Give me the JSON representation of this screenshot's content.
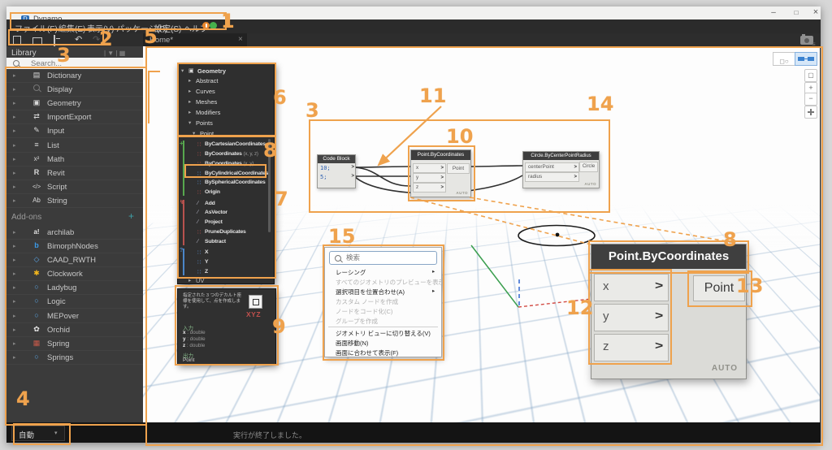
{
  "window": {
    "title": "Dynamo"
  },
  "menu": {
    "items": [
      "ファイル(F)",
      "編集(E)",
      "表示(V)",
      "パッケージ(P)",
      "設定(S)",
      "ヘルプ"
    ]
  },
  "tab": {
    "label": "Home*"
  },
  "library": {
    "title": "Library",
    "search_placeholder": "Search...",
    "categories": [
      {
        "label": "Dictionary",
        "icon": "book-icon"
      },
      {
        "label": "Display",
        "icon": "magnifier-icon"
      },
      {
        "label": "Geometry",
        "icon": "cube-icon"
      },
      {
        "label": "ImportExport",
        "icon": "arrows-icon"
      },
      {
        "label": "Input",
        "icon": "pen-icon"
      },
      {
        "label": "List",
        "icon": "list-icon"
      },
      {
        "label": "Math",
        "icon": "math-icon"
      },
      {
        "label": "Revit",
        "icon": "revit-icon"
      },
      {
        "label": "Script",
        "icon": "code-icon"
      },
      {
        "label": "String",
        "icon": "text-icon"
      }
    ],
    "addons_title": "Add-ons",
    "addons": [
      {
        "label": "archilab",
        "icon": "archilab-icon"
      },
      {
        "label": "BimorphNodes",
        "icon": "bimorph-icon"
      },
      {
        "label": "CAAD_RWTH",
        "icon": "package-icon"
      },
      {
        "label": "Clockwork",
        "icon": "gear-icon"
      },
      {
        "label": "Ladybug",
        "icon": "package-icon"
      },
      {
        "label": "Logic",
        "icon": "package-icon"
      },
      {
        "label": "MEPover",
        "icon": "package-icon"
      },
      {
        "label": "Orchid",
        "icon": "flower-icon"
      },
      {
        "label": "Spring",
        "icon": "spring-icon"
      },
      {
        "label": "Springs",
        "icon": "package-icon"
      }
    ]
  },
  "runbar": {
    "mode": "自動",
    "status": "実行が終了しました。"
  },
  "tree": {
    "root": "Geometry",
    "cats": [
      "Abstract",
      "Curves",
      "Meshes",
      "Modifiers",
      "Points",
      "Point"
    ],
    "create": [
      {
        "name": "ByCartesianCoordinates",
        "params": ""
      },
      {
        "name": "ByCoordinates",
        "params": "(x, y, z)"
      },
      {
        "name": "ByCoordinates",
        "params": "(x, y)"
      },
      {
        "name": "ByCylindricalCoordinates",
        "params": ""
      },
      {
        "name": "BySphericalCoordinates",
        "params": ""
      },
      {
        "name": "Origin",
        "params": ""
      }
    ],
    "action": [
      "Add",
      "AsVector",
      "Project",
      "PruneDuplicates",
      "Subtract"
    ],
    "query": [
      "X",
      "Y",
      "Z"
    ],
    "footer": "UV"
  },
  "tooltip": {
    "desc": "指定された 3 つのデカルト座標を使用して、点を作成します。",
    "icon_text": "XYZ",
    "inputs_title": "入力",
    "rows": [
      {
        "n": "x",
        "t": " : double"
      },
      {
        "n": "y",
        "t": " : double"
      },
      {
        "n": "z",
        "t": " : double"
      }
    ],
    "outputs_title": "出力",
    "output": "Point"
  },
  "graph": {
    "code_block": {
      "title": "Code Block",
      "lines": [
        "10;",
        "5;"
      ]
    },
    "point": {
      "title": "Point.ByCoordinates",
      "in0": "x",
      "in1": "y",
      "in2": "z",
      "output": "Point",
      "badge": "AUTO"
    },
    "circle": {
      "title": "Circle.ByCenterPointRadius",
      "in0": "centerPoint",
      "in1": "radius",
      "output": "Circle",
      "badge": "AUTO"
    }
  },
  "context_menu": {
    "search_placeholder": "検索",
    "items": [
      "レーシング",
      "すべてのジオメトリのプレビューを表示",
      "選択項目を位置合わせ(A)",
      "カスタム ノードを作成",
      "ノードをコード化(C)",
      "グループを作成",
      "ジオメトリ ビューに切り替える(V)",
      "画面移動(N)",
      "画面に合わせて表示(F)"
    ]
  },
  "annotations": {
    "n1": "1",
    "n2": "2",
    "n3": "3",
    "n3b": "3",
    "n4": "4",
    "n5": "5",
    "n6": "6",
    "n7": "7",
    "n8": "8",
    "n8b": "8",
    "n9": "9",
    "n10": "10",
    "n11": "11",
    "n12": "12",
    "n13": "13",
    "n14": "14",
    "n15": "15"
  },
  "colors": {
    "accent": "#efa24d",
    "node_header": "#3f3f3f",
    "canvas": "#fdfdfd"
  }
}
